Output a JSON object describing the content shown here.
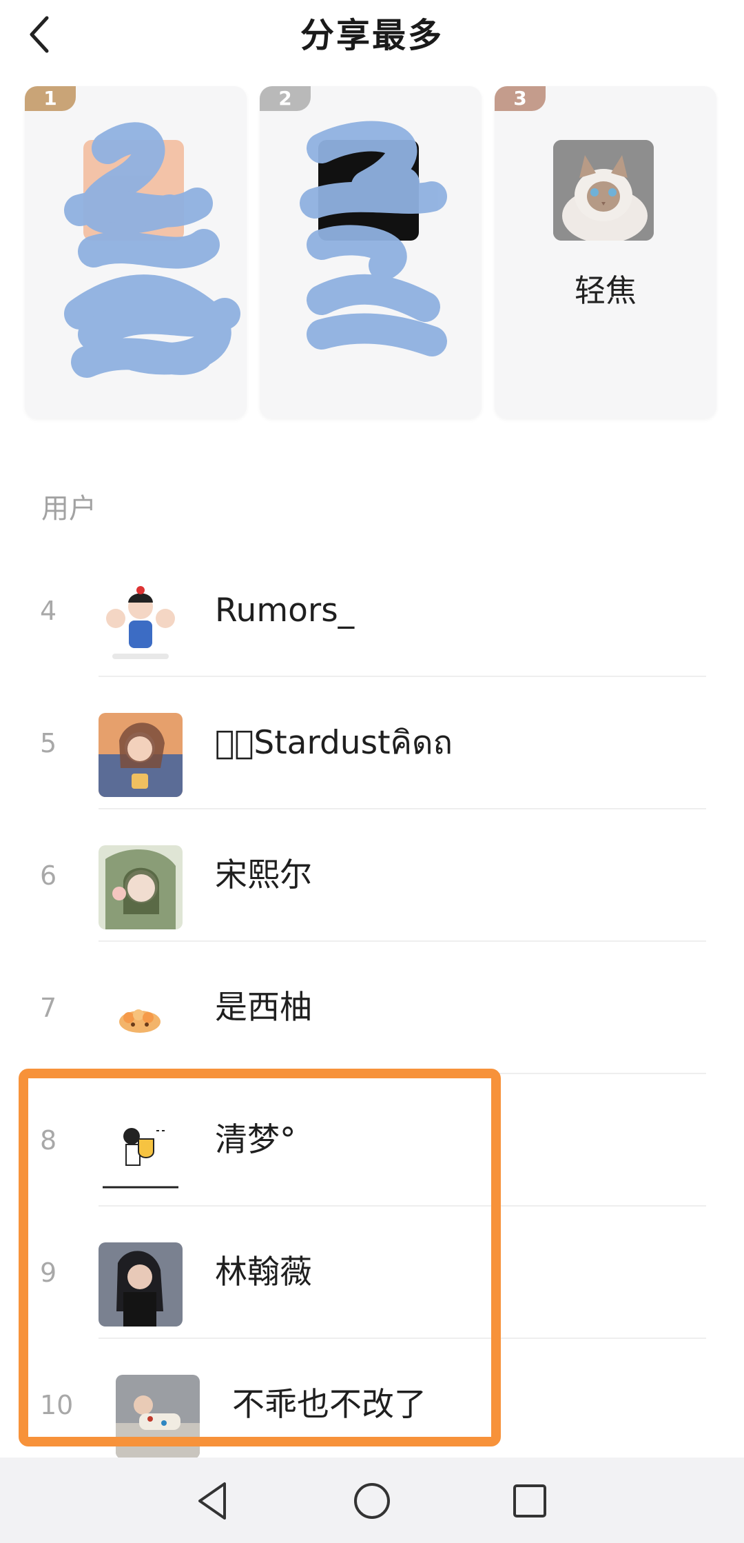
{
  "header": {
    "title": "分享最多"
  },
  "top_cards": [
    {
      "rank": "1",
      "name": "",
      "tab_color": "#c9a477"
    },
    {
      "rank": "2",
      "name": "",
      "tab_color": "#b9b9b9"
    },
    {
      "rank": "3",
      "name": "轻焦",
      "tab_color": "#c49c8c"
    }
  ],
  "section": {
    "users_label": "用户"
  },
  "users": [
    {
      "rank": "4",
      "name": "Rumors_"
    },
    {
      "rank": "5",
      "name": "ஞ⃝Stardustคิดถ"
    },
    {
      "rank": "6",
      "name": "宋熙尔"
    },
    {
      "rank": "7",
      "name": "是西柚"
    },
    {
      "rank": "8",
      "name": "清梦°"
    },
    {
      "rank": "9",
      "name": "林翰薇"
    },
    {
      "rank": "10",
      "name": "不乖也不改了"
    }
  ],
  "colors": {
    "highlight_border": "#f7923a",
    "redaction": "#8fb1e0",
    "rank_text": "#a8a8a8"
  },
  "icons": {
    "back": "chevron-left-icon",
    "nav_back": "triangle-back-icon",
    "nav_home": "circle-home-icon",
    "nav_recent": "square-recent-icon"
  }
}
